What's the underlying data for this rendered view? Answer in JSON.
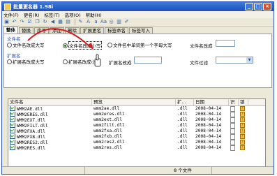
{
  "window": {
    "title": "批量更名器 1.98i"
  },
  "menu": [
    "文件(F)",
    "更名(R)",
    "标签(T)",
    "选项(O)",
    "帮助(H)"
  ],
  "tabs": [
    "整体",
    "替换",
    "序号",
    "添加",
    "删除",
    "扩展更名",
    "标签命名",
    "标签写入"
  ],
  "filename_group": {
    "title": "文件名",
    "opt_upper": "文件名改成大写",
    "opt_lower": "文件名改成小写",
    "opt_word_cap": "文件名中单词第一个字母大写",
    "field_label": "文件名改成"
  },
  "ext_group": {
    "title": "扩展名",
    "opt_upper": "扩展名改成大写",
    "opt_lower": "扩展名改成小写",
    "field_label": "扩展名改成",
    "filter_label": "文件过滤"
  },
  "grid": {
    "columns": [
      "文件名",
      "预览",
      "扩...",
      "日期",
      "识",
      "锁"
    ],
    "rows": [
      {
        "name": "WMM2AE.dll",
        "preview": "wmm2ae.dll",
        "ext": ".dll",
        "date": "2008-04-14"
      },
      {
        "name": "WMM2ERES.dll",
        "preview": "wmm2eres.dll",
        "ext": ".dll",
        "date": "2008-04-14"
      },
      {
        "name": "WMM2EXT.dll",
        "preview": "wmm2ext.dll",
        "ext": ".dll",
        "date": "2008-04-14"
      },
      {
        "name": "WMM2FILT.dll",
        "preview": "wmm2filt.dll",
        "ext": ".dll",
        "date": "2008-04-14"
      },
      {
        "name": "WMM2FXA.dll",
        "preview": "wmm2fxa.dll",
        "ext": ".dll",
        "date": "2008-04-14"
      },
      {
        "name": "WMM2FXB.dll",
        "preview": "wmm2fxb.dll",
        "ext": ".dll",
        "date": "2008-04-14"
      },
      {
        "name": "WMM2RES2.dll",
        "preview": "wmm2res2.dll",
        "ext": ".dll",
        "date": "2008-04-14"
      },
      {
        "name": "WMM2RES.dll",
        "preview": "wmm2res.dll",
        "ext": ".dll",
        "date": "2008-04-14"
      }
    ]
  },
  "status": {
    "count": "8 个文件"
  },
  "toolbar_icons": [
    "open-folder-icon",
    "undo-icon",
    "redo-icon",
    "checkbox-icon",
    "copy-icon",
    "refresh-icon",
    "back-icon",
    "select-all-icon",
    "grid-icon",
    "brush-icon",
    "font-a-icon",
    "font-a-small-icon",
    "font-a-case-icon",
    "target-icon",
    "save-icon",
    "pen-icon"
  ],
  "colors": {
    "accent": "#2a50b8",
    "title_bar": "#1f4fbd",
    "arrow": "#d02020"
  }
}
